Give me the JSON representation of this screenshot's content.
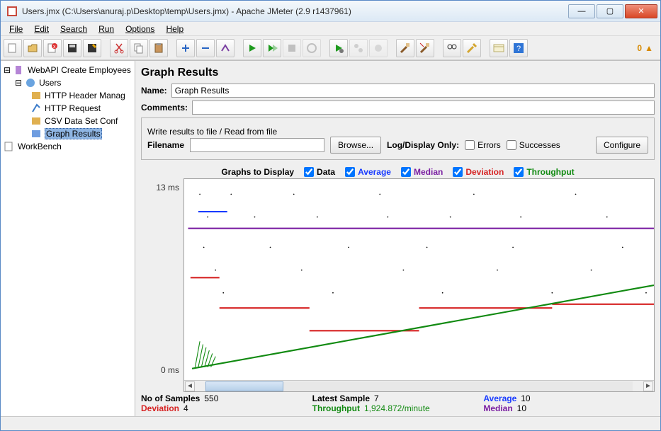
{
  "window": {
    "title": "Users.jmx (C:\\Users\\anuraj.p\\Desktop\\temp\\Users.jmx) - Apache JMeter (2.9 r1437961)"
  },
  "menu": [
    "File",
    "Edit",
    "Search",
    "Run",
    "Options",
    "Help"
  ],
  "toolbar_badge": "0",
  "tree": {
    "root": "WebAPI Create Employees",
    "users": "Users",
    "children": [
      "HTTP Header Manag",
      "HTTP Request",
      "CSV Data Set Conf",
      "Graph Results"
    ],
    "workbench": "WorkBench"
  },
  "panel": {
    "title": "Graph Results",
    "name_label": "Name:",
    "name_value": "Graph Results",
    "comments_label": "Comments:",
    "file_group": "Write results to file / Read from file",
    "filename_label": "Filename",
    "browse": "Browse...",
    "log_display": "Log/Display Only:",
    "errors": "Errors",
    "successes": "Successes",
    "configure": "Configure",
    "graphs_label": "Graphs to Display",
    "series": {
      "data": "Data",
      "average": "Average",
      "median": "Median",
      "deviation": "Deviation",
      "throughput": "Throughput"
    },
    "y_top": "13 ms",
    "y_bot": "0 ms"
  },
  "colors": {
    "data": "#000000",
    "average": "#1a3cff",
    "median": "#7a1fa2",
    "deviation": "#d62222",
    "throughput": "#118a11"
  },
  "stats": {
    "samples_k": "No of Samples",
    "samples_v": "550",
    "latest_k": "Latest Sample",
    "latest_v": "7",
    "average_k": "Average",
    "average_v": "10",
    "deviation_k": "Deviation",
    "deviation_v": "4",
    "throughput_k": "Throughput",
    "throughput_v": "1,924.872/minute",
    "median_k": "Median",
    "median_v": "10"
  },
  "chart_data": {
    "type": "line",
    "title": "Graph Results",
    "ylabel": "ms",
    "ylim": [
      0,
      13
    ],
    "xlim_samples": [
      1,
      550
    ],
    "series": [
      {
        "name": "Median",
        "color": "#7a1fa2",
        "approx": "horizontal line at ~10 ms across full width"
      },
      {
        "name": "Average",
        "color": "#1a3cff",
        "approx": "short segment ~11 ms near left edge"
      },
      {
        "name": "Deviation",
        "color": "#d62222",
        "approx": "stepwise segments descending from ~7 ms to ~5 ms left-to-right"
      },
      {
        "name": "Throughput",
        "color": "#118a11",
        "approx": "monotone increasing from ~0 ms (left) to ~6 ms (right)"
      },
      {
        "name": "Data",
        "color": "#000000",
        "approx": "scatter dots concentrated 7–12 ms"
      }
    ]
  }
}
